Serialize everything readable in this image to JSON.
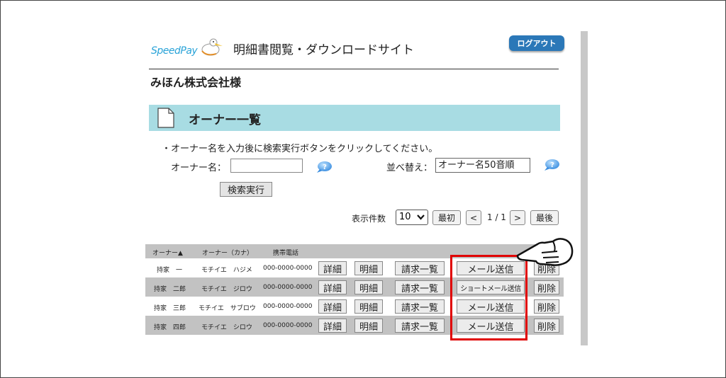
{
  "header": {
    "logo_text": "SpeedPay",
    "site_title": "明細書閲覧・ダウンロードサイト",
    "logout_label": "ログアウト"
  },
  "company_name": "みほん株式会社様",
  "section": {
    "title": "オーナー一覧"
  },
  "search": {
    "instruction": "・オーナー名を入力後に検索実行ボタンをクリックしてください。",
    "owner_label": "オーナー名：",
    "owner_value": "",
    "sort_label": "並べ替え：",
    "sort_value": "オーナー名50音順",
    "search_button": "検索実行"
  },
  "pagination": {
    "per_page_label": "表示件数",
    "per_page_value": "10",
    "first_label": "最初",
    "prev_label": "<",
    "page_info": "1 / 1",
    "next_label": ">",
    "last_label": "最後"
  },
  "table": {
    "headers": [
      "オーナー▲",
      "オーナー（カナ）",
      "携帯電話"
    ],
    "rows": [
      {
        "name": "持家　一",
        "kana": "モチイエ　ハジメ",
        "phone": "000-0000-0000",
        "detail": "詳細",
        "meisai": "明細",
        "invoice": "請求一覧",
        "mail": "メール送信",
        "delete": "削除"
      },
      {
        "name": "持家　二郎",
        "kana": "モチイエ　ジロウ",
        "phone": "000-0000-0000",
        "detail": "詳細",
        "meisai": "明細",
        "invoice": "請求一覧",
        "mail": "ショートメール送信",
        "delete": "削除"
      },
      {
        "name": "持家　三郎",
        "kana": "モチイエ　サブロウ",
        "phone": "000-0000-0000",
        "detail": "詳細",
        "meisai": "明細",
        "invoice": "請求一覧",
        "mail": "メール送信",
        "delete": "削除"
      },
      {
        "name": "持家　四郎",
        "kana": "モチイエ　シロウ",
        "phone": "000-0000-0000",
        "detail": "詳細",
        "meisai": "明細",
        "invoice": "請求一覧",
        "mail": "メール送信",
        "delete": "削除"
      }
    ]
  },
  "colors": {
    "section_bar": "#a8dce3",
    "logout_button": "#2b78b8",
    "highlight_box": "#e00000",
    "row_alt": "#c2c2c2",
    "logo_text": "#29a3d8"
  },
  "icons": {
    "help": "speech-bubble-help-icon",
    "document": "document-icon",
    "pointer": "pointing-hand-icon"
  }
}
